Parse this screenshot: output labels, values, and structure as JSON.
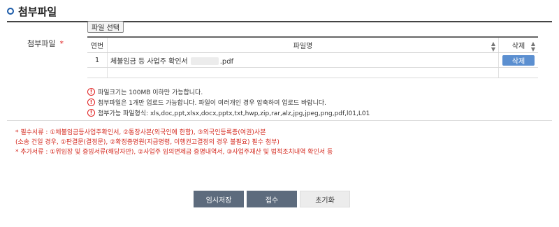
{
  "section": {
    "title": "첨부파일"
  },
  "field": {
    "label": "첨부파일",
    "required_mark": "*"
  },
  "file_button": {
    "label": "파일 선택"
  },
  "table": {
    "headers": {
      "no": "연번",
      "name": "파일명",
      "del": "삭제"
    },
    "rows": [
      {
        "no": "1",
        "name_prefix": "체불임금 등 사업주 확인서",
        "name_suffix": ".pdf",
        "del": "삭제"
      }
    ]
  },
  "notes": [
    "파일크기는 100MB 이하만 가능합니다.",
    "첨부파일은 1개만 업로드 가능합니다. 파일이 여러개인 경우 압축하여 업로드 바랍니다.",
    "첨부가능 파일형식: xls,doc,ppt,xlsx,docx,pptx,txt,hwp,zip,rar,alz,jpg,jpeg,png,pdf,l01,L01"
  ],
  "required_docs": [
    "* 필수서류 : ①체불임금등사업주확인서, ②통장사본(외국인에 한함), ③외국인등록증(여권)사본",
    "(소송 건일 경우, ①판결문(결정문), ②확정증명원(지급명령, 이행권고결정의 경우 불필요) 필수 첨부)",
    "* 추가서류 : ①위임장 및 증빙서류(해당자만), ②사업주 임의변제금 증명내역서, ③사업주재산 및 법적조치내역 확인서 등"
  ],
  "actions": {
    "save_draft": "임시저장",
    "submit": "접수",
    "reset": "초기화"
  },
  "colors": {
    "accent": "#5b8fd0",
    "danger": "#d4281e",
    "dark_button": "#5d6b7d"
  }
}
